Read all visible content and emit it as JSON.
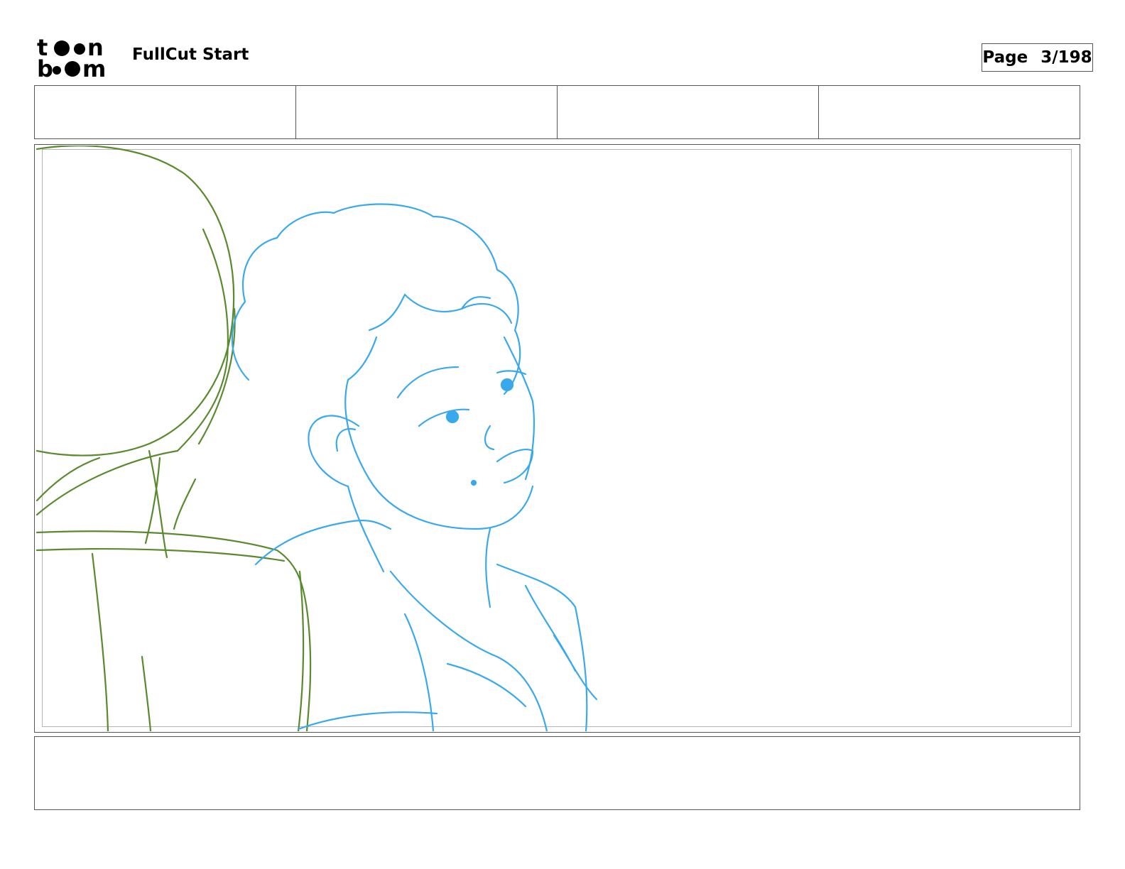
{
  "header": {
    "logo": {
      "line1": "toon",
      "line2": "boom"
    },
    "project_title": "FullCut Start",
    "page_label": "Page",
    "page_value": "3/198"
  },
  "info_cells": [
    "",
    "",
    "",
    ""
  ],
  "panel": {
    "sketch_colors": {
      "background_character": "#5a8a2e",
      "foreground_character": "#3aa9ec"
    }
  },
  "notes": {
    "text": ""
  }
}
